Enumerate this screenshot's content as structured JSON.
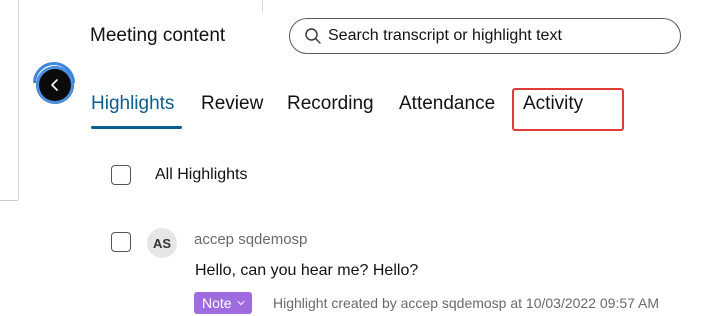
{
  "header": {
    "title": "Meeting content",
    "search_placeholder": "Search transcript or highlight text"
  },
  "tabs": [
    {
      "label": "Highlights",
      "active": true
    },
    {
      "label": "Review",
      "active": false
    },
    {
      "label": "Recording",
      "active": false
    },
    {
      "label": "Attendance",
      "active": false
    },
    {
      "label": "Activity",
      "active": false,
      "callout": true
    }
  ],
  "filter": {
    "all_label": "All Highlights",
    "checked": false
  },
  "highlights": [
    {
      "avatar_initials": "AS",
      "author": "accep sqdemosp",
      "text": "Hello, can you hear me? Hello?",
      "tag": "Note",
      "meta": "Highlight created by accep sqdemosp at 10/03/2022 09:57 AM",
      "checked": false
    }
  ],
  "colors": {
    "active_tab": "#0a5d8f",
    "callout_border": "#e23b36",
    "note_badge": "#9f6ce0"
  },
  "icons": {
    "search": "search-icon",
    "back": "chevron-left-icon",
    "tag_dropdown": "chevron-down-icon"
  }
}
